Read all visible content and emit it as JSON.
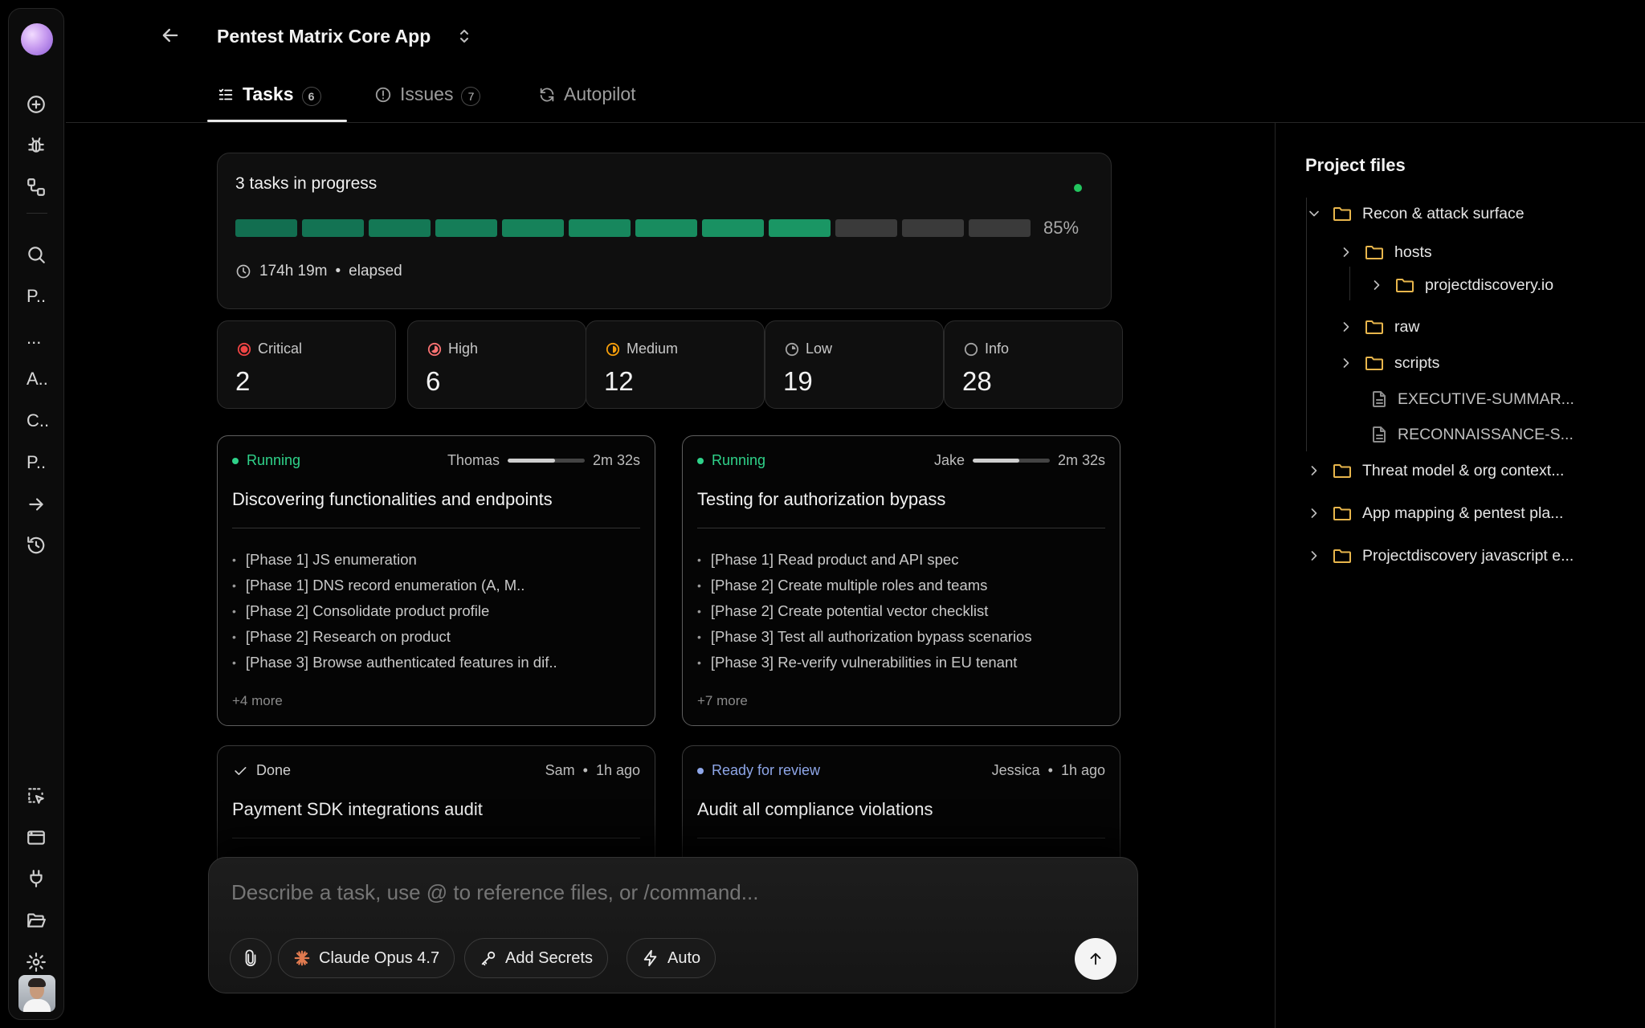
{
  "header": {
    "project_title": "Pentest Matrix Core App",
    "tabs": [
      {
        "label": "Tasks",
        "count": "6"
      },
      {
        "label": "Issues",
        "count": "7"
      },
      {
        "label": "Autopilot"
      }
    ]
  },
  "sidebar": {
    "text_items": [
      "P..",
      "...",
      "A..",
      "C..",
      "P.."
    ]
  },
  "progress": {
    "title": "3 tasks in progress",
    "percent_label": "85%",
    "segments_total": 12,
    "segments_filled": 9,
    "elapsed_time": "174h 19m",
    "elapsed_separator": "•",
    "elapsed_label": "elapsed",
    "status_color": "#22c55e"
  },
  "severity": [
    {
      "label": "Critical",
      "value": "2",
      "color": "#ef4444"
    },
    {
      "label": "High",
      "value": "6",
      "color": "#f87171"
    },
    {
      "label": "Medium",
      "value": "12",
      "color": "#f59e0b"
    },
    {
      "label": "Low",
      "value": "19",
      "color": "#a3a3a3"
    },
    {
      "label": "Info",
      "value": "28",
      "color": "#a3a3a3"
    }
  ],
  "tasks": [
    {
      "status": "Running",
      "status_color": "#2fd28a",
      "assignee": "Thomas",
      "progress": 0.62,
      "time": "2m 32s",
      "title": "Discovering functionalities and endpoints",
      "items": [
        "[Phase 1] JS enumeration",
        "[Phase 1] DNS record enumeration (A, M..",
        "[Phase 2] Consolidate product profile",
        "[Phase 2] Research on product",
        "[Phase 3] Browse authenticated features in dif.."
      ],
      "more": "+4 more"
    },
    {
      "status": "Running",
      "status_color": "#2fd28a",
      "assignee": "Jake",
      "progress": 0.6,
      "time": "2m 32s",
      "title": "Testing for authorization bypass",
      "items": [
        "[Phase 1] Read product and API spec",
        "[Phase 2] Create multiple roles and teams",
        "[Phase 2] Create potential vector checklist",
        "[Phase 3] Test all authorization bypass scenarios",
        "[Phase 3] Re-verify vulnerabilities in EU tenant"
      ],
      "more": "+7 more"
    },
    {
      "status": "Done",
      "status_color": "#cfcfcf",
      "assignee": "Sam",
      "separator": "•",
      "time": "1h ago",
      "title": "Payment SDK integrations audit"
    },
    {
      "status": "Ready for review",
      "status_color": "#8ea6e8",
      "assignee": "Jessica",
      "separator": "•",
      "time": "1h ago",
      "title": "Audit all compliance violations"
    }
  ],
  "composer": {
    "placeholder": "Describe a task, use @ to reference files, or /command...",
    "model_label": "Claude Opus 4.7",
    "secrets_label": "Add Secrets",
    "mode_label": "Auto"
  },
  "files_panel": {
    "title": "Project files",
    "tree": [
      {
        "label": "Recon & attack surface",
        "type": "folder",
        "expanded": true
      },
      {
        "label": "hosts",
        "type": "folder"
      },
      {
        "label": "projectdiscovery.io",
        "type": "folder"
      },
      {
        "label": "raw",
        "type": "folder"
      },
      {
        "label": "scripts",
        "type": "folder"
      },
      {
        "label": "EXECUTIVE-SUMMAR...",
        "type": "file"
      },
      {
        "label": "RECONNAISSANCE-S...",
        "type": "file"
      },
      {
        "label": "Threat model & org context...",
        "type": "folder"
      },
      {
        "label": "App mapping & pentest pla...",
        "type": "folder"
      },
      {
        "label": "Projectdiscovery javascript e...",
        "type": "folder"
      }
    ]
  }
}
